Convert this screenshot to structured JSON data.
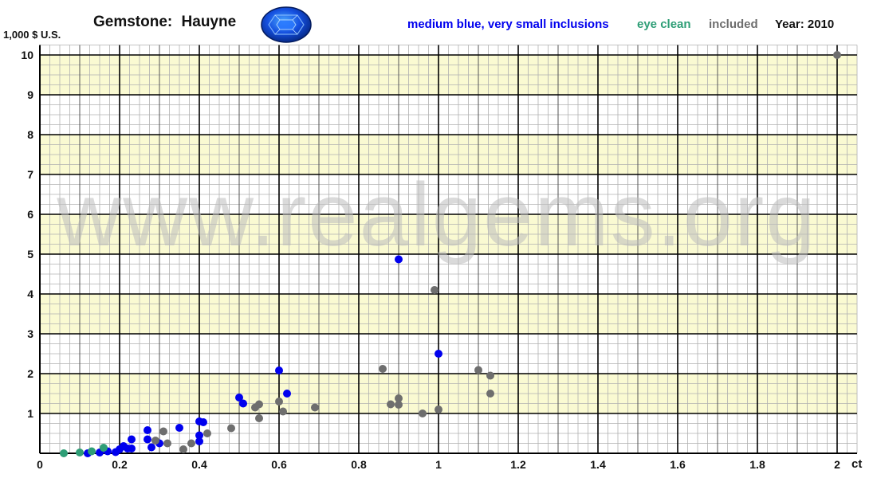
{
  "header": {
    "title_prefix": "Gemstone:",
    "gem_name": "Hauyne",
    "gem_icon": "blue-faceted-gem-icon",
    "year": "Year: 2010"
  },
  "watermark": "www.realgems.org",
  "colors": {
    "medium_blue": "#0000ee",
    "eye_clean": "#2e9e76",
    "included": "#6e6e6e",
    "band_yellow": "#fafad2",
    "grid_minor": "#b0b0b0",
    "grid_major": "#000000"
  },
  "chart_data": {
    "type": "scatter",
    "title": "Gemstone: Hauyne",
    "xlabel": "ct",
    "ylabel": "1,000 $ U.S.",
    "xlim": [
      0,
      2.05
    ],
    "ylim": [
      0,
      10.25
    ],
    "x_ticks": [
      "0",
      "0.2",
      "0.4",
      "0.6",
      "0.8",
      "1",
      "1.2",
      "1.4",
      "1.6",
      "1.8",
      "2"
    ],
    "x_tick_values": [
      0,
      0.2,
      0.4,
      0.6,
      0.8,
      1,
      1.2,
      1.4,
      1.6,
      1.8,
      2
    ],
    "y_ticks": [
      "1",
      "2",
      "3",
      "4",
      "5",
      "6",
      "7",
      "8",
      "9",
      "10"
    ],
    "y_tick_values": [
      1,
      2,
      3,
      4,
      5,
      6,
      7,
      8,
      9,
      10
    ],
    "grid": true,
    "legend_position": "top-right",
    "series": [
      {
        "name": "medium blue, very small inclusions",
        "color": "#0000ee",
        "points": [
          [
            0.12,
            0.0
          ],
          [
            0.15,
            0.02
          ],
          [
            0.17,
            0.05
          ],
          [
            0.19,
            0.03
          ],
          [
            0.2,
            0.1
          ],
          [
            0.21,
            0.18
          ],
          [
            0.22,
            0.12
          ],
          [
            0.23,
            0.35
          ],
          [
            0.23,
            0.12
          ],
          [
            0.27,
            0.58
          ],
          [
            0.27,
            0.35
          ],
          [
            0.28,
            0.15
          ],
          [
            0.3,
            0.25
          ],
          [
            0.35,
            0.64
          ],
          [
            0.4,
            0.8
          ],
          [
            0.41,
            0.78
          ],
          [
            0.4,
            0.45
          ],
          [
            0.4,
            0.3
          ],
          [
            0.5,
            1.4
          ],
          [
            0.51,
            1.25
          ],
          [
            0.6,
            2.08
          ],
          [
            0.62,
            1.5
          ],
          [
            0.9,
            4.87
          ],
          [
            1.0,
            2.5
          ]
        ]
      },
      {
        "name": "eye clean",
        "color": "#2e9e76",
        "points": [
          [
            0.06,
            0.0
          ],
          [
            0.1,
            0.02
          ],
          [
            0.13,
            0.05
          ],
          [
            0.16,
            0.14
          ]
        ]
      },
      {
        "name": "included",
        "color": "#6e6e6e",
        "points": [
          [
            0.29,
            0.32
          ],
          [
            0.31,
            0.55
          ],
          [
            0.32,
            0.25
          ],
          [
            0.36,
            0.1
          ],
          [
            0.38,
            0.25
          ],
          [
            0.42,
            0.5
          ],
          [
            0.48,
            0.63
          ],
          [
            0.54,
            1.15
          ],
          [
            0.55,
            1.23
          ],
          [
            0.55,
            0.88
          ],
          [
            0.6,
            1.3
          ],
          [
            0.61,
            1.05
          ],
          [
            0.69,
            1.15
          ],
          [
            0.86,
            2.12
          ],
          [
            0.88,
            1.23
          ],
          [
            0.9,
            1.38
          ],
          [
            0.9,
            1.22
          ],
          [
            0.96,
            1.0
          ],
          [
            0.99,
            4.1
          ],
          [
            1.0,
            1.1
          ],
          [
            1.1,
            2.09
          ],
          [
            1.13,
            1.95
          ],
          [
            1.13,
            1.5
          ],
          [
            2.0,
            10.0
          ]
        ]
      }
    ]
  }
}
